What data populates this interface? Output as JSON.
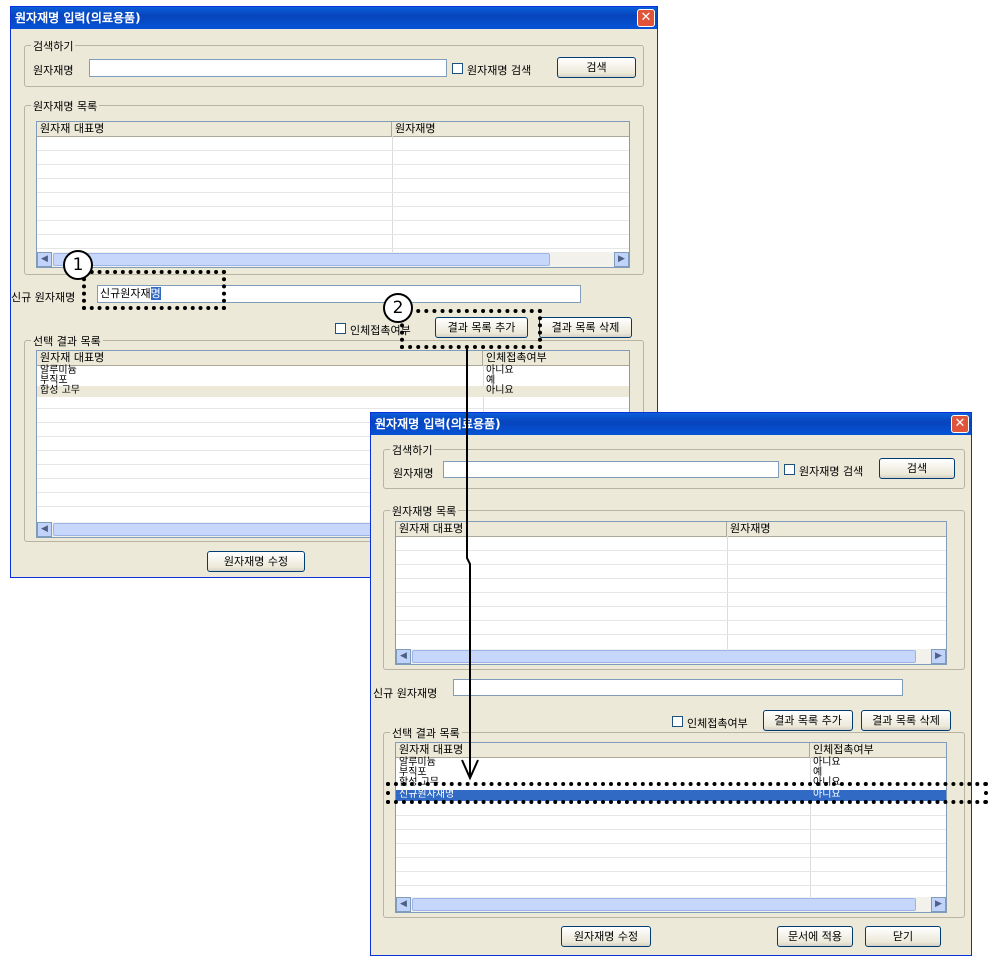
{
  "window": {
    "title": "원자재명 입력(의료용품)",
    "close_glyph": "✕"
  },
  "search": {
    "group_label": "검색하기",
    "field_label": "원자재명",
    "value": "",
    "checkbox_label": "원자재명 검색",
    "button_label": "검색"
  },
  "material_list": {
    "group_label": "원자재명 목록",
    "columns": [
      "원자재 대표명",
      "원자재명"
    ]
  },
  "new_material": {
    "label": "신규 원자재명",
    "value_before": "신규원자재",
    "value_selected": "명",
    "value_window2": ""
  },
  "options": {
    "contact_checkbox_label": "인체접촉여부",
    "add_button": "결과 목록 추가",
    "delete_button": "결과 목록 삭제"
  },
  "result_list": {
    "group_label": "선택 결과 목록",
    "columns": [
      "원자재 대표명",
      "인체접촉여부"
    ],
    "rows": [
      {
        "name": "알루미늄",
        "contact": "아니요"
      },
      {
        "name": "부직포",
        "contact": "예"
      },
      {
        "name": "합성 고무",
        "contact": "아니요"
      }
    ],
    "added_row": {
      "name": "신규원자재명",
      "contact": "아니요"
    }
  },
  "footer": {
    "edit_button": "원자재명 수정",
    "apply_button": "문서에 적용",
    "close_button": "닫기"
  },
  "callouts": {
    "step1": "1",
    "step2": "2"
  },
  "colors": {
    "titlebar": "#0553d6",
    "window_bg": "#ece9d8",
    "selection": "#316ac5"
  }
}
